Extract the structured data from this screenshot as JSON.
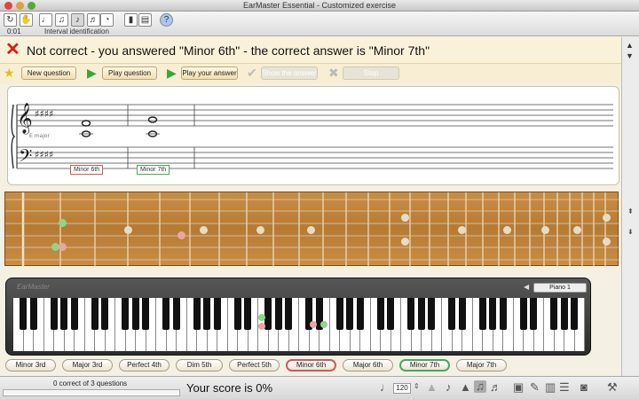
{
  "window": {
    "title": "EarMaster Essential - Customized exercise"
  },
  "toolbar": {
    "elapsed": "0:01",
    "mode_label": "Interval identification"
  },
  "feedback": {
    "icon": "x-icon",
    "message": "Not correct - you answered \"Minor 6th\" - the correct answer is \"Minor 7th\""
  },
  "actions": {
    "new_question": "New question",
    "play_question": "Play question",
    "play_answer": "Play your answer",
    "show_answer": "Show the answer",
    "stop": "Stop"
  },
  "staff": {
    "key_label": "E major",
    "answered_label": "Minor 6th",
    "correct_label": "Minor 7th"
  },
  "keyboard": {
    "brand": "EarMaster",
    "instrument": "Piano 1"
  },
  "answers": [
    {
      "label": "Minor 3rd",
      "state": "normal"
    },
    {
      "label": "Major 3rd",
      "state": "normal"
    },
    {
      "label": "Perfect 4th",
      "state": "normal"
    },
    {
      "label": "Dim 5th",
      "state": "normal"
    },
    {
      "label": "Perfect 5th",
      "state": "normal"
    },
    {
      "label": "Minor 6th",
      "state": "wrong"
    },
    {
      "label": "Major 6th",
      "state": "normal"
    },
    {
      "label": "Minor 7th",
      "state": "correct"
    },
    {
      "label": "Major 7th",
      "state": "normal"
    }
  ],
  "status": {
    "progress_text": "0 correct of 3 questions",
    "score_text": "Your score is 0%",
    "tempo": "120"
  },
  "colors": {
    "wrong": "#d05a5a",
    "correct": "#4aa85a",
    "error_icon": "#d61a12"
  }
}
